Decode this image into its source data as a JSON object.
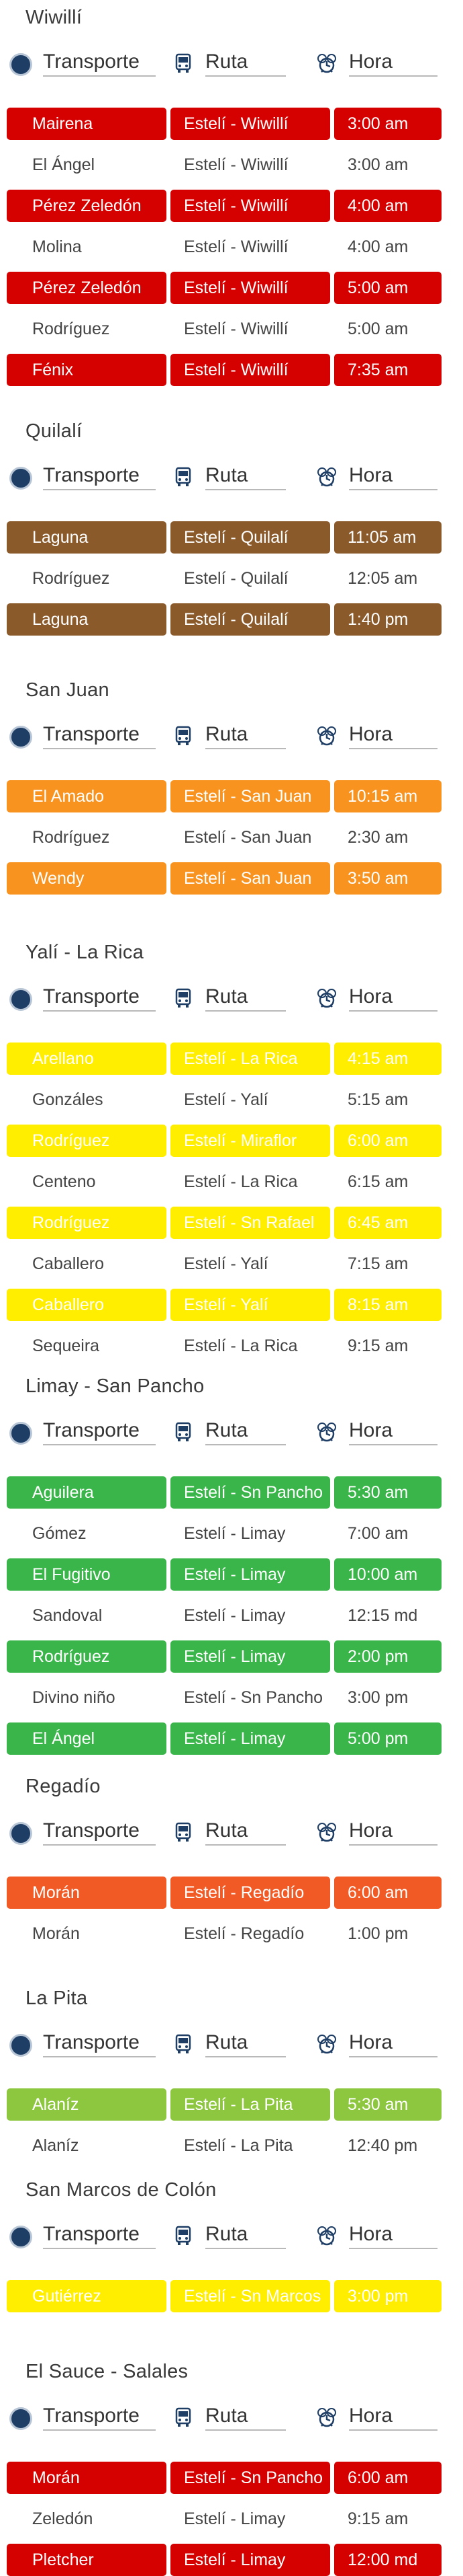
{
  "header_labels": {
    "transport": "Transporte",
    "route": "Ruta",
    "time": "Hora"
  },
  "icons": {
    "transport": "bullet-circle-icon",
    "route": "bus-icon",
    "time": "clock-icon"
  },
  "colors": {
    "red": "#d50000",
    "brown": "#8b5a2b",
    "orange": "#f7931e",
    "yellow": "#ffee00",
    "green": "#39b54a",
    "deep_orange": "#f15a24",
    "lime": "#8dc63f"
  },
  "sections": [
    {
      "title": "Wiwillí",
      "rows": [
        {
          "transport": "Mairena",
          "route": "Estelí - Wiwillí",
          "time": "3:00 am",
          "color": "red"
        },
        {
          "transport": "El Ángel",
          "route": "Estelí - Wiwillí",
          "time": "3:00 am",
          "color": ""
        },
        {
          "transport": "Pérez Zeledón",
          "route": "Estelí - Wiwillí",
          "time": "4:00 am",
          "color": "red"
        },
        {
          "transport": "Molina",
          "route": "Estelí - Wiwillí",
          "time": "4:00 am",
          "color": ""
        },
        {
          "transport": "Pérez Zeledón",
          "route": "Estelí - Wiwillí",
          "time": "5:00 am",
          "color": "red"
        },
        {
          "transport": "Rodríguez",
          "route": "Estelí - Wiwillí",
          "time": "5:00 am",
          "color": ""
        },
        {
          "transport": "Fénix",
          "route": "Estelí - Wiwillí",
          "time": "7:35 am",
          "color": "red"
        }
      ]
    },
    {
      "title": "Quilalí",
      "rows": [
        {
          "transport": "Laguna",
          "route": "Estelí - Quilalí",
          "time": "11:05 am",
          "color": "brown"
        },
        {
          "transport": "Rodríguez",
          "route": "Estelí - Quilalí",
          "time": "12:05 am",
          "color": ""
        },
        {
          "transport": "Laguna",
          "route": "Estelí - Quilalí",
          "time": "1:40 pm",
          "color": "brown"
        }
      ]
    },
    {
      "title": "San Juan",
      "rows": [
        {
          "transport": "El Amado",
          "route": "Estelí - San Juan",
          "time": "10:15 am",
          "color": "orange"
        },
        {
          "transport": "Rodríguez",
          "route": "Estelí - San Juan",
          "time": "2:30 am",
          "color": ""
        },
        {
          "transport": "Wendy",
          "route": "Estelí - San Juan",
          "time": "3:50 am",
          "color": "orange"
        }
      ]
    },
    {
      "title": "Yalí - La Rica",
      "rows": [
        {
          "transport": "Arellano",
          "route": "Estelí - La Rica",
          "time": "4:15 am",
          "color": "yellow"
        },
        {
          "transport": "Gonzáles",
          "route": "Estelí - Yalí",
          "time": "5:15 am",
          "color": ""
        },
        {
          "transport": "Rodríguez",
          "route": "Estelí - Miraflor",
          "time": "6:00 am",
          "color": "yellow"
        },
        {
          "transport": "Centeno",
          "route": "Estelí - La Rica",
          "time": "6:15 am",
          "color": ""
        },
        {
          "transport": "Rodríguez",
          "route": "Estelí - Sn Rafael",
          "time": "6:45 am",
          "color": "yellow"
        },
        {
          "transport": "Caballero",
          "route": "Estelí - Yalí",
          "time": "7:15 am",
          "color": ""
        },
        {
          "transport": "Caballero",
          "route": "Estelí - Yalí",
          "time": "8:15 am",
          "color": "yellow"
        },
        {
          "transport": "Sequeira",
          "route": "Estelí - La Rica",
          "time": "9:15 am",
          "color": ""
        }
      ]
    },
    {
      "title": "Limay - San Pancho",
      "rows": [
        {
          "transport": "Aguilera",
          "route": "Estelí - Sn Pancho",
          "time": "5:30 am",
          "color": "green"
        },
        {
          "transport": "Gómez",
          "route": "Estelí - Limay",
          "time": "7:00 am",
          "color": ""
        },
        {
          "transport": "El Fugitivo",
          "route": "Estelí - Limay",
          "time": "10:00 am",
          "color": "green"
        },
        {
          "transport": "Sandoval",
          "route": "Estelí - Limay",
          "time": "12:15 md",
          "color": ""
        },
        {
          "transport": "Rodríguez",
          "route": "Estelí - Limay",
          "time": "2:00 pm",
          "color": "green"
        },
        {
          "transport": "Divino niño",
          "route": "Estelí - Sn Pancho",
          "time": "3:00 pm",
          "color": ""
        },
        {
          "transport": "El Ángel",
          "route": "Estelí - Limay",
          "time": "5:00 pm",
          "color": "green"
        }
      ]
    },
    {
      "title": "Regadío",
      "rows": [
        {
          "transport": "Morán",
          "route": "Estelí - Regadío",
          "time": "6:00 am",
          "color": "deep_orange"
        },
        {
          "transport": "Morán",
          "route": "Estelí - Regadío",
          "time": "1:00 pm",
          "color": ""
        }
      ]
    },
    {
      "title": "La Pita",
      "rows": [
        {
          "transport": "Alaníz",
          "route": "Estelí - La Pita",
          "time": "5:30 am",
          "color": "lime"
        },
        {
          "transport": "Alaníz",
          "route": "Estelí - La Pita",
          "time": "12:40 pm",
          "color": ""
        }
      ]
    },
    {
      "title": "San Marcos de Colón",
      "rows": [
        {
          "transport": "Gutiérrez",
          "route": "Estelí - Sn Marcos",
          "time": "3:00 pm",
          "color": "yellow"
        }
      ]
    },
    {
      "title": "El Sauce - Salales",
      "rows": [
        {
          "transport": "Morán",
          "route": "Estelí - Sn Pancho",
          "time": "6:00 am",
          "color": "red"
        },
        {
          "transport": "Zeledón",
          "route": "Estelí - Limay",
          "time": "9:15 am",
          "color": ""
        },
        {
          "transport": "Pletcher",
          "route": "Estelí - Limay",
          "time": "12:00 md",
          "color": "red"
        }
      ]
    }
  ]
}
